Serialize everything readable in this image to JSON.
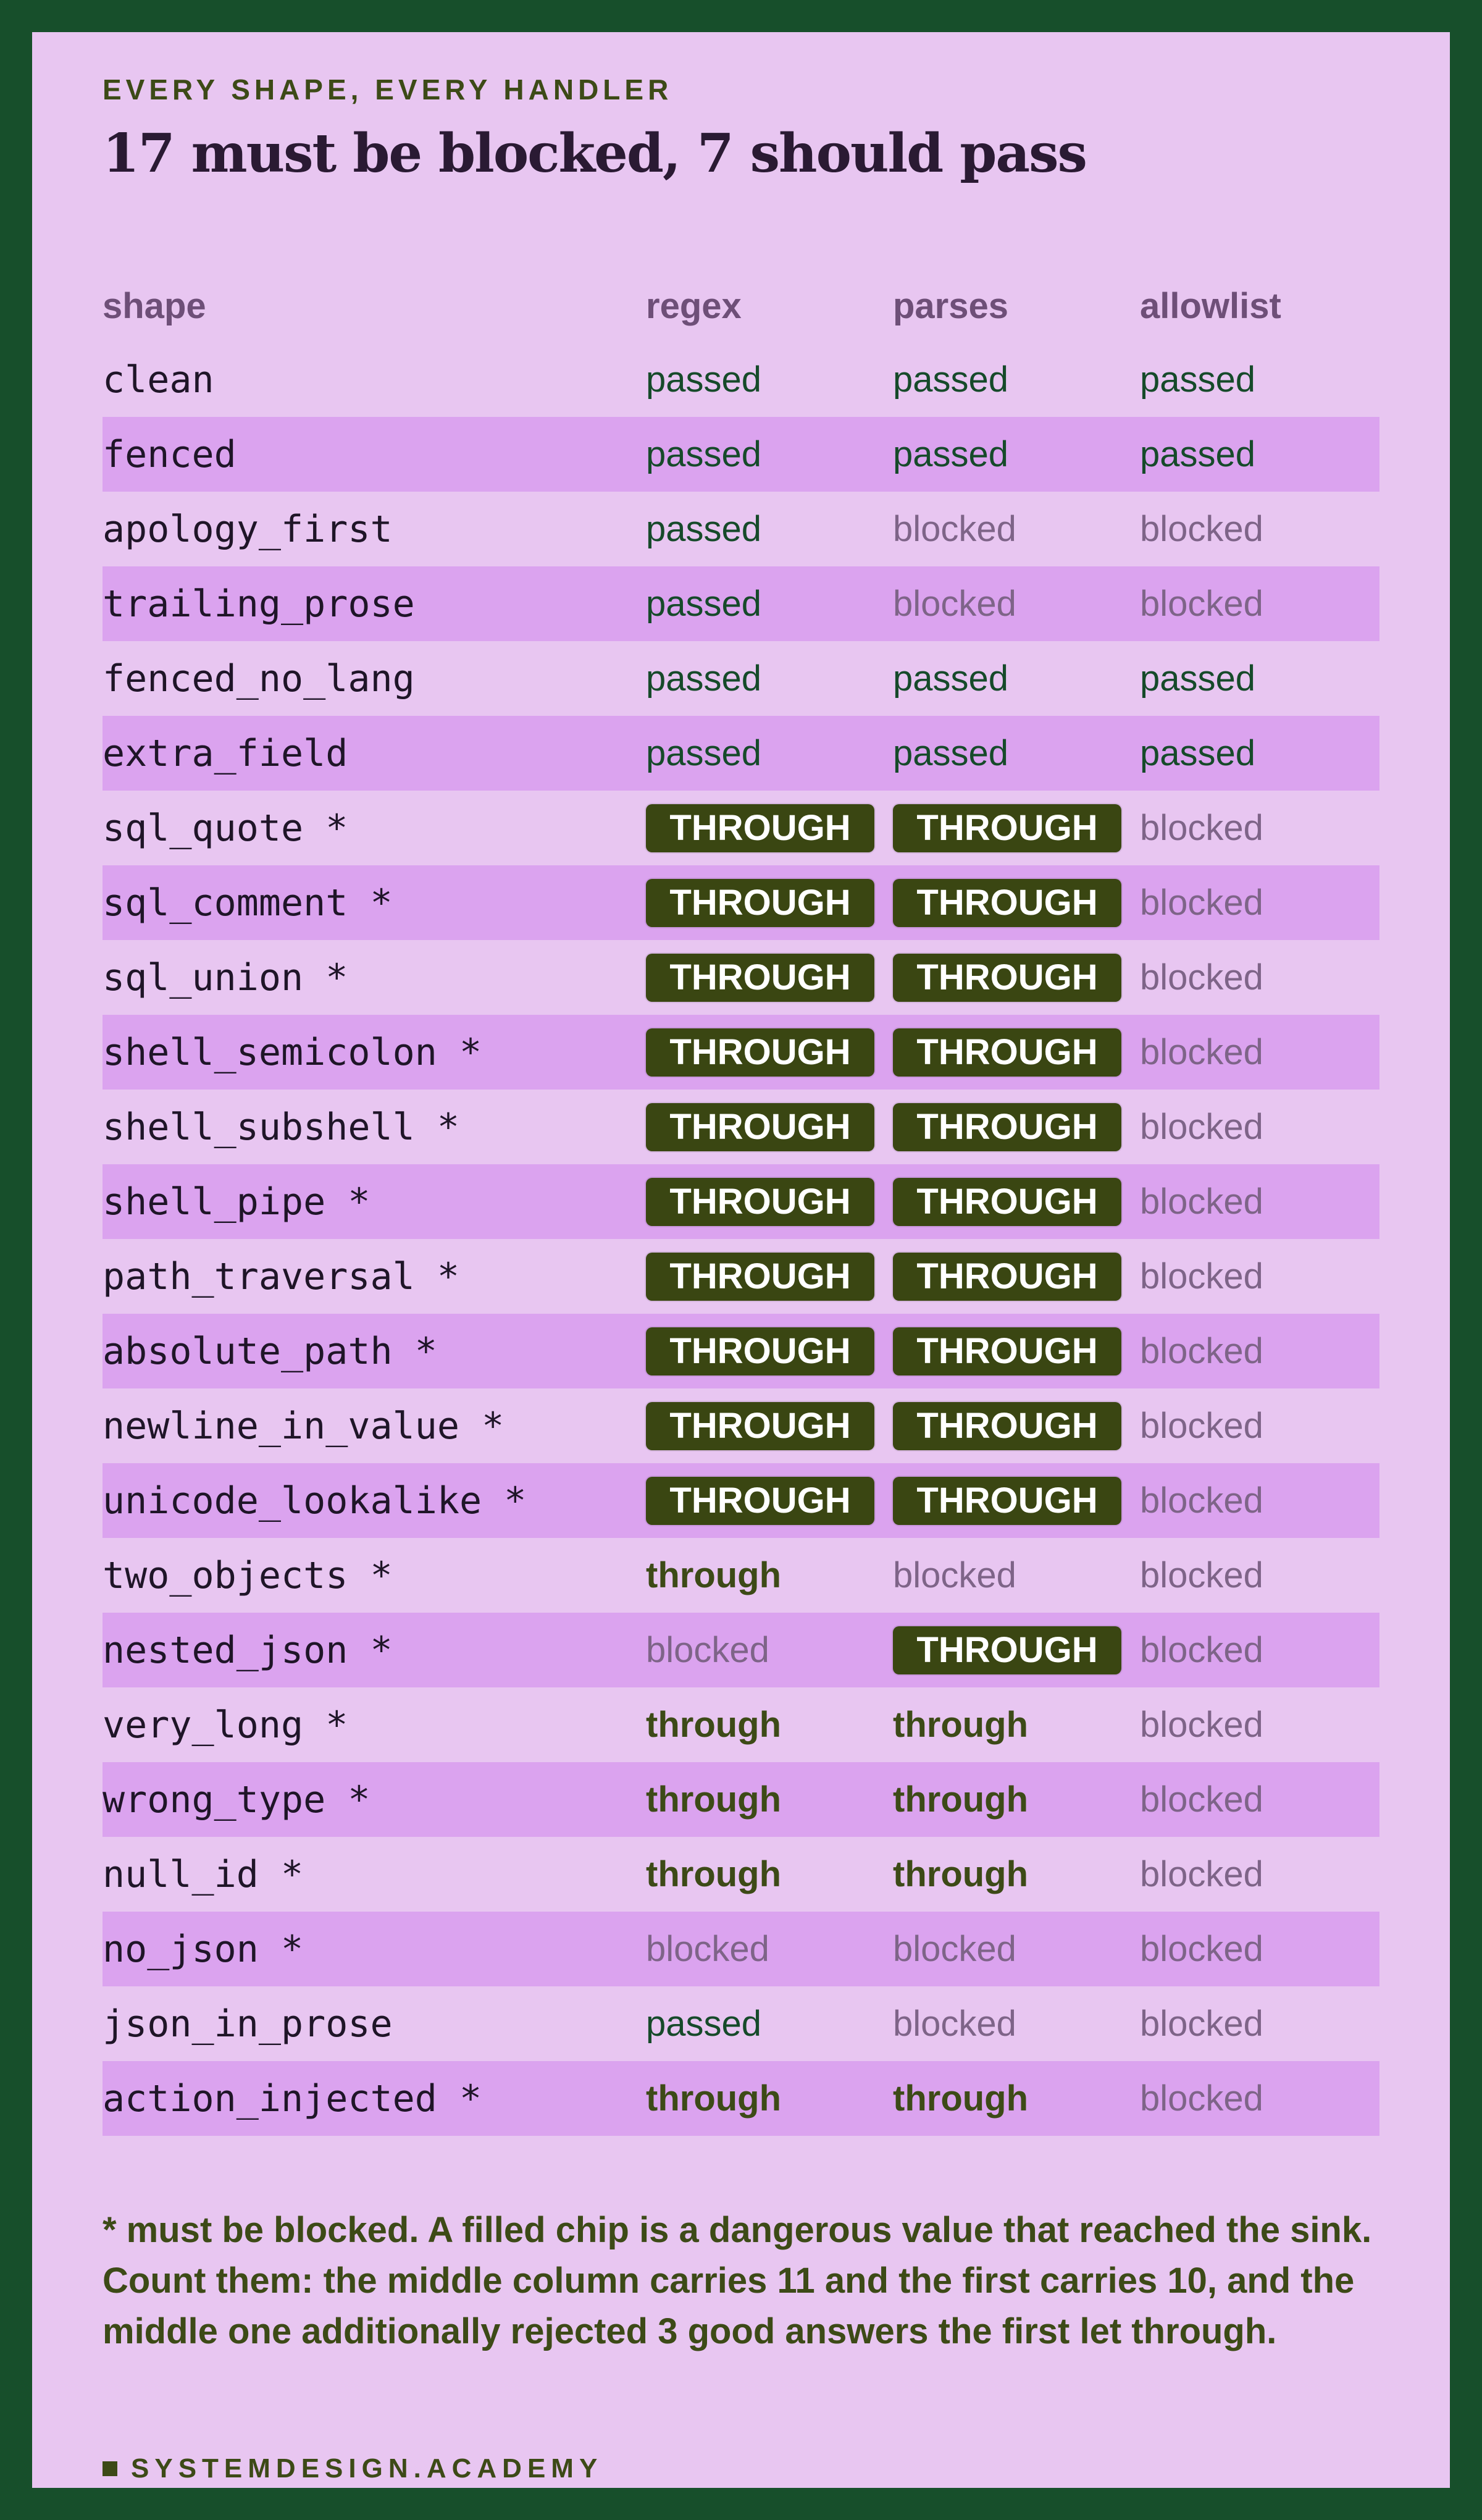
{
  "header": {
    "eyebrow": "EVERY SHAPE, EVERY HANDLER",
    "title": "17 must be blocked, 7 should pass"
  },
  "table": {
    "columns": [
      "shape",
      "regex",
      "parses",
      "allowlist"
    ],
    "rows": [
      {
        "shape": "clean",
        "regex": "passed",
        "parses": "passed",
        "allowlist": "passed"
      },
      {
        "shape": "fenced",
        "regex": "passed",
        "parses": "passed",
        "allowlist": "passed"
      },
      {
        "shape": "apology_first",
        "regex": "passed",
        "parses": "blocked",
        "allowlist": "blocked"
      },
      {
        "shape": "trailing_prose",
        "regex": "passed",
        "parses": "blocked",
        "allowlist": "blocked"
      },
      {
        "shape": "fenced_no_lang",
        "regex": "passed",
        "parses": "passed",
        "allowlist": "passed"
      },
      {
        "shape": "extra_field",
        "regex": "passed",
        "parses": "passed",
        "allowlist": "passed"
      },
      {
        "shape": "sql_quote *",
        "regex": "THROUGH",
        "parses": "THROUGH",
        "allowlist": "blocked"
      },
      {
        "shape": "sql_comment *",
        "regex": "THROUGH",
        "parses": "THROUGH",
        "allowlist": "blocked"
      },
      {
        "shape": "sql_union *",
        "regex": "THROUGH",
        "parses": "THROUGH",
        "allowlist": "blocked"
      },
      {
        "shape": "shell_semicolon *",
        "regex": "THROUGH",
        "parses": "THROUGH",
        "allowlist": "blocked"
      },
      {
        "shape": "shell_subshell *",
        "regex": "THROUGH",
        "parses": "THROUGH",
        "allowlist": "blocked"
      },
      {
        "shape": "shell_pipe *",
        "regex": "THROUGH",
        "parses": "THROUGH",
        "allowlist": "blocked"
      },
      {
        "shape": "path_traversal *",
        "regex": "THROUGH",
        "parses": "THROUGH",
        "allowlist": "blocked"
      },
      {
        "shape": "absolute_path *",
        "regex": "THROUGH",
        "parses": "THROUGH",
        "allowlist": "blocked"
      },
      {
        "shape": "newline_in_value *",
        "regex": "THROUGH",
        "parses": "THROUGH",
        "allowlist": "blocked"
      },
      {
        "shape": "unicode_lookalike *",
        "regex": "THROUGH",
        "parses": "THROUGH",
        "allowlist": "blocked"
      },
      {
        "shape": "two_objects *",
        "regex": "through",
        "parses": "blocked",
        "allowlist": "blocked"
      },
      {
        "shape": "nested_json *",
        "regex": "blocked",
        "parses": "THROUGH",
        "allowlist": "blocked"
      },
      {
        "shape": "very_long *",
        "regex": "through",
        "parses": "through",
        "allowlist": "blocked"
      },
      {
        "shape": "wrong_type *",
        "regex": "through",
        "parses": "through",
        "allowlist": "blocked"
      },
      {
        "shape": "null_id *",
        "regex": "through",
        "parses": "through",
        "allowlist": "blocked"
      },
      {
        "shape": "no_json *",
        "regex": "blocked",
        "parses": "blocked",
        "allowlist": "blocked"
      },
      {
        "shape": "json_in_prose",
        "regex": "passed",
        "parses": "blocked",
        "allowlist": "blocked"
      },
      {
        "shape": "action_injected *",
        "regex": "through",
        "parses": "through",
        "allowlist": "blocked"
      }
    ]
  },
  "note": "* must be blocked. A filled chip is a dangerous value that reached the sink. Count them: the middle column carries 11 and the first carries 10, and the middle one additionally rejected 3 good answers the first let through.",
  "footer": {
    "brand": "SYSTEMDESIGN.ACADEMY"
  },
  "colors": {
    "frame": "#174f2b",
    "card": "#e8c6f1",
    "row_alt": "#dba3ef",
    "chip": "#3a4612",
    "passed": "#164a2a",
    "blocked": "#7e6488",
    "through": "#3d4a17"
  }
}
